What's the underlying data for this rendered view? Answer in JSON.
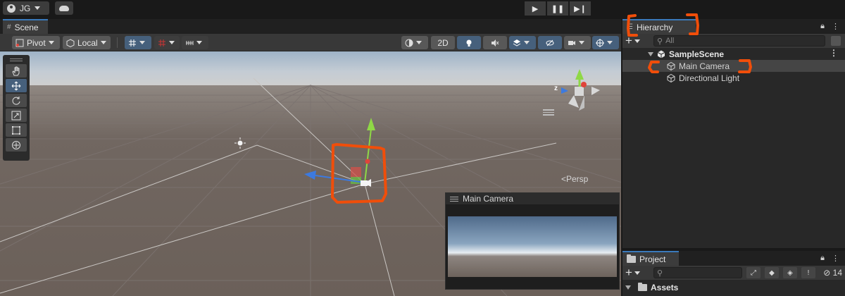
{
  "account": {
    "initials": "JG"
  },
  "scene_panel": {
    "tab_label": "Scene",
    "pivot_label": "Pivot",
    "local_label": "Local",
    "mode_2d": "2D",
    "persp_label": "<Persp",
    "gizmo_axis_z": "z"
  },
  "game_view_preview": {
    "title": "Main Camera"
  },
  "tools": [
    "hand-tool",
    "move-tool",
    "rotate-tool",
    "scale-tool",
    "rect-tool",
    "transform-tool"
  ],
  "hierarchy": {
    "tab_label": "Hierarchy",
    "search_placeholder": "All",
    "scene_name": "SampleScene",
    "items": [
      {
        "label": "Main Camera",
        "selected": true
      },
      {
        "label": "Directional Light",
        "selected": false
      }
    ]
  },
  "project": {
    "tab_label": "Project",
    "hidden_count": "14",
    "root_folder": "Assets"
  },
  "colors": {
    "annotation": "#f04e0a",
    "selection_blue": "#46607c",
    "axis_x": "#e0443a",
    "axis_y": "#8fd846",
    "axis_z": "#3c7ae0"
  }
}
